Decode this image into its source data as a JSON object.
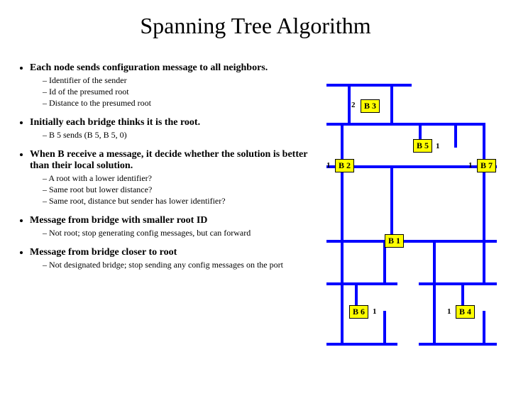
{
  "title": "Spanning Tree Algorithm",
  "bullets": {
    "b1": "Each node sends configuration message to all neighbors.",
    "b1s1": "Identifier of the sender",
    "b1s2": "Id of the presumed root",
    "b1s3": "Distance to the presumed root",
    "b2": "Initially each bridge thinks it is the root.",
    "b2s1": "B 5 sends (B 5, B 5, 0)",
    "b3": "When B receive a message, it decide whether the solution is better than their local solution.",
    "b3s1": "A root with a lower identifier?",
    "b3s2": "Same root but lower distance?",
    "b3s3": "Same root, distance but sender has lower identifier?",
    "b4": "Message from bridge with smaller root ID",
    "b4s1": "Not root; stop generating config messages, but can forward",
    "b5": "Message from bridge closer to root",
    "b5s1": "Not designated bridge; stop sending  any config messages on the port"
  },
  "nodes": {
    "n_b3": "B 3",
    "n_b5": "B 5",
    "n_b2": "B 2",
    "n_b7": "B 7",
    "n_b1": "B 1",
    "n_b6": "B 6",
    "n_b4": "B 4"
  },
  "ports": {
    "p_b3_2": "2",
    "p_b5_1": "1",
    "p_b2_1": "1",
    "p_b7_1": "1",
    "p_b6_1": "1",
    "p_b4_1": "1"
  }
}
